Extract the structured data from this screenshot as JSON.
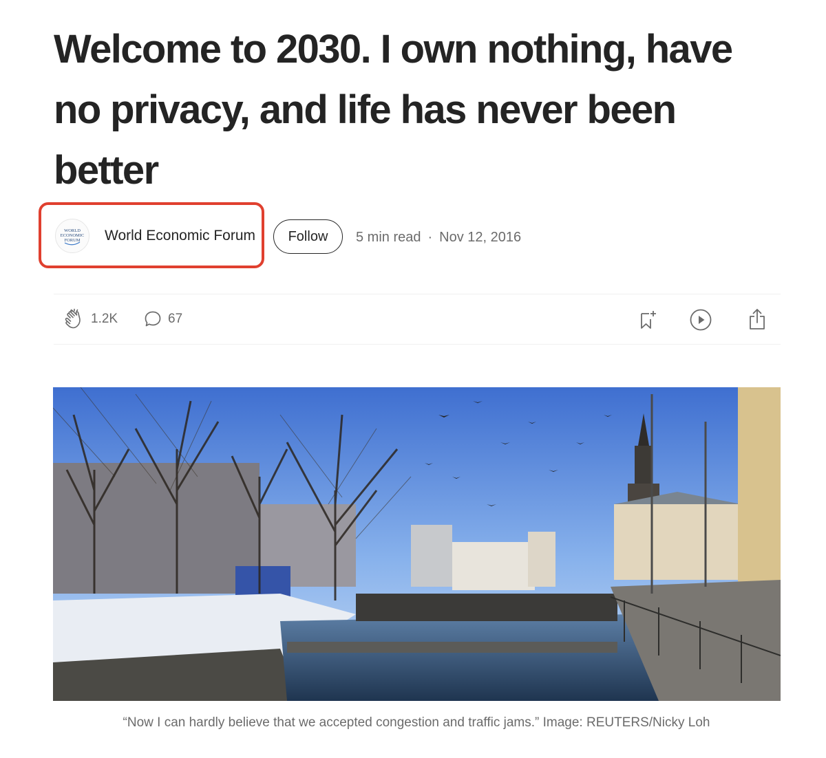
{
  "article": {
    "title": "Welcome to 2030. I own nothing, have no privacy, and life has never been better",
    "author": {
      "name": "World Economic Forum",
      "avatar_icon": "wef-logo-icon",
      "avatar_text": [
        "WORLD",
        "ECONOMIC",
        "FORUM"
      ]
    },
    "follow_label": "Follow",
    "read_time": "5 min read",
    "separator": "·",
    "date": "Nov 12, 2016",
    "highlight_color": "#e0402f"
  },
  "actions": {
    "claps": "1.2K",
    "clap_icon": "clap-icon",
    "comments": "67",
    "comment_icon": "comment-icon",
    "save_icon": "bookmark-add-icon",
    "listen_icon": "play-circle-icon",
    "share_icon": "share-icon"
  },
  "hero_image": {
    "caption": "“Now I can hardly believe that we accepted congestion and traffic jams.” Image: REUTERS/Nicky Loh"
  }
}
